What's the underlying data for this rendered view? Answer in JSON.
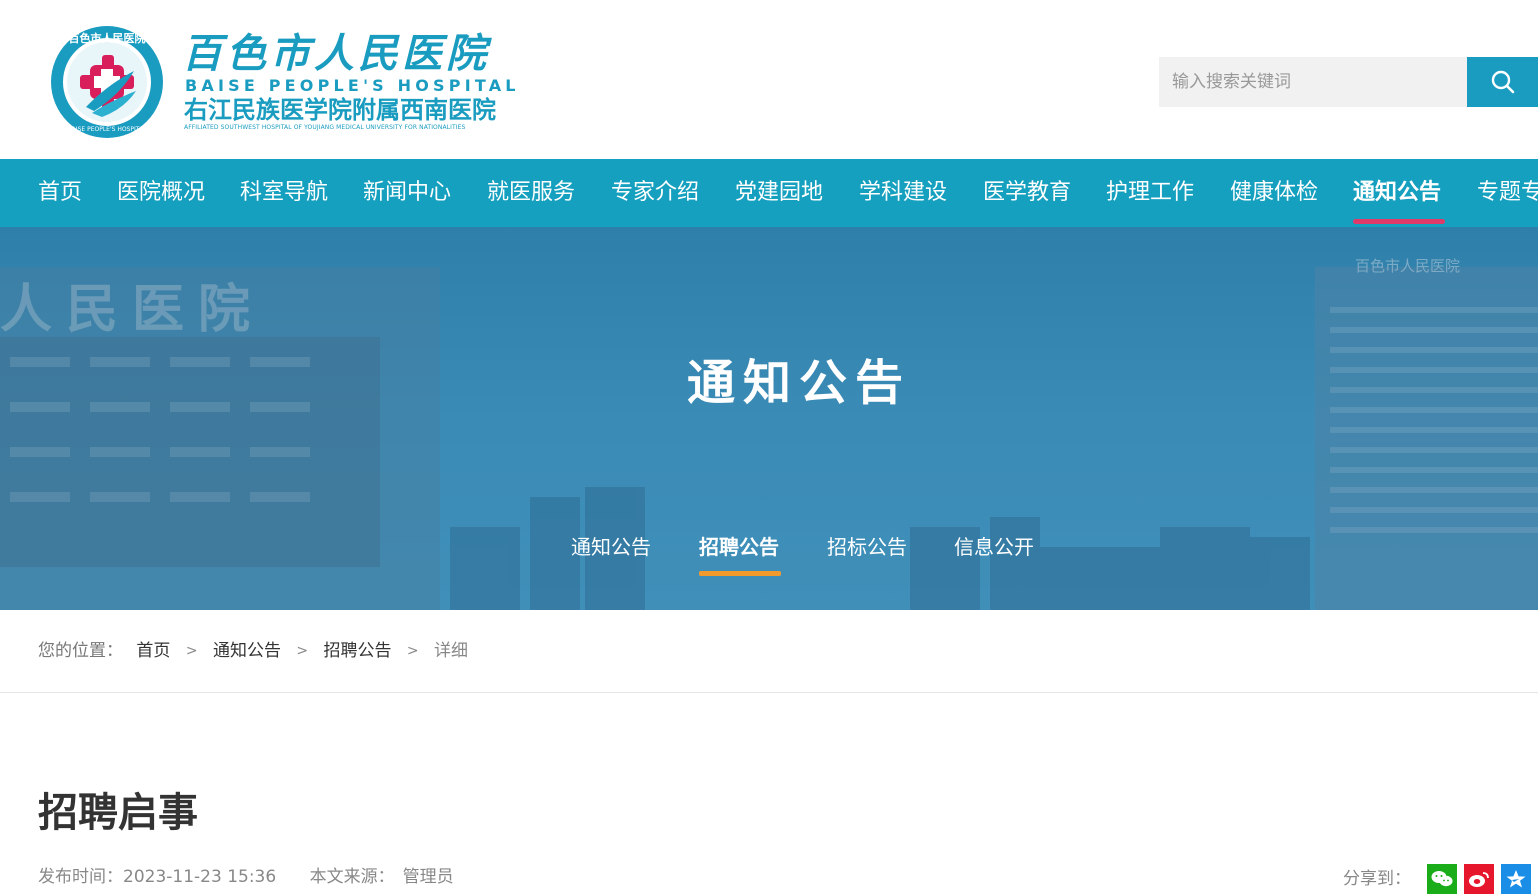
{
  "header": {
    "logo_cn": "百色市人民医院",
    "logo_en": "BAISE PEOPLE'S HOSPITAL",
    "logo_sub": "右江民族医学院附属西南医院",
    "logo_sub_en": "AFFILIATED SOUTHWEST HOSPITAL OF YOUJIANG MEDICAL UNIVERSITY FOR NATIONALITIES",
    "emblem_ring_text": "百色市人民医院",
    "emblem_ring_en": "BAISE PEOPLE'S HOSPITAL",
    "search_placeholder": "输入搜索关键词",
    "search_icon": "search-icon"
  },
  "nav": {
    "items": [
      {
        "label": "首页"
      },
      {
        "label": "医院概况"
      },
      {
        "label": "科室导航"
      },
      {
        "label": "新闻中心"
      },
      {
        "label": "就医服务"
      },
      {
        "label": "专家介绍"
      },
      {
        "label": "党建园地"
      },
      {
        "label": "学科建设"
      },
      {
        "label": "医学教育"
      },
      {
        "label": "护理工作"
      },
      {
        "label": "健康体检"
      },
      {
        "label": "通知公告"
      },
      {
        "label": "专题专栏"
      }
    ],
    "active": "通知公告",
    "accent": "#e03a6a",
    "bg": "#15a0bf"
  },
  "banner": {
    "title": "通知公告",
    "building_sign_left": "人民医院",
    "building_sign_right": "百色市人民医院",
    "subnav": [
      {
        "label": "通知公告"
      },
      {
        "label": "招聘公告"
      },
      {
        "label": "招标公告"
      },
      {
        "label": "信息公开"
      }
    ],
    "active": "招聘公告",
    "accent": "#f39a2c"
  },
  "breadcrumb": {
    "prefix": "您的位置：",
    "items": [
      {
        "label": "首页"
      },
      {
        "label": "通知公告"
      },
      {
        "label": "招聘公告"
      }
    ],
    "current": "详细"
  },
  "article": {
    "title": "招聘启事",
    "publish_label": "发布时间：",
    "publish_time": "2023-11-23 15:36",
    "source_label": "本文来源：",
    "source": "管理员",
    "share_label": "分享到：",
    "share": [
      {
        "name": "wechat-icon",
        "color": "#1aad19"
      },
      {
        "name": "weibo-icon",
        "color": "#e6162d"
      },
      {
        "name": "qzone-icon",
        "color": "#1a8ee6"
      }
    ]
  }
}
